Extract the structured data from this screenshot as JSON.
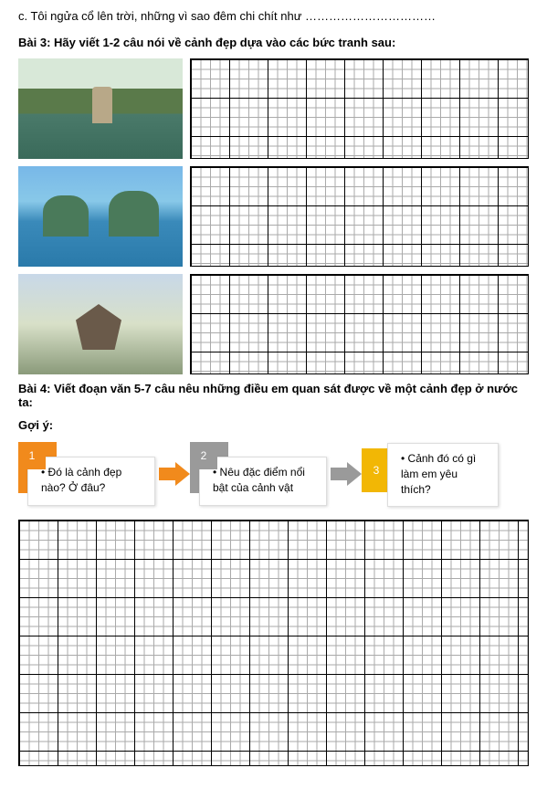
{
  "intro_line": "c. Tôi ngửa cổ lên trời, những vì sao đêm chi chít như ……………………………",
  "bai3_heading": "Bài 3: Hãy viết 1-2 câu nói về cảnh đẹp dựa vào các bức tranh sau:",
  "bai4_heading": "Bài 4: Viết đoạn văn 5-7 câu nêu những điều em quan sát được về một cảnh đẹp ở nước ta:",
  "goiy_label": "Gợi ý:",
  "hints": [
    {
      "num": "1",
      "text": "Đó là cảnh đẹp nào? Ở đâu?"
    },
    {
      "num": "2",
      "text": "Nêu đặc điểm nổi bật của cảnh vật"
    },
    {
      "num": "3",
      "text": "Cảnh đó có gì làm em yêu thích?"
    }
  ]
}
